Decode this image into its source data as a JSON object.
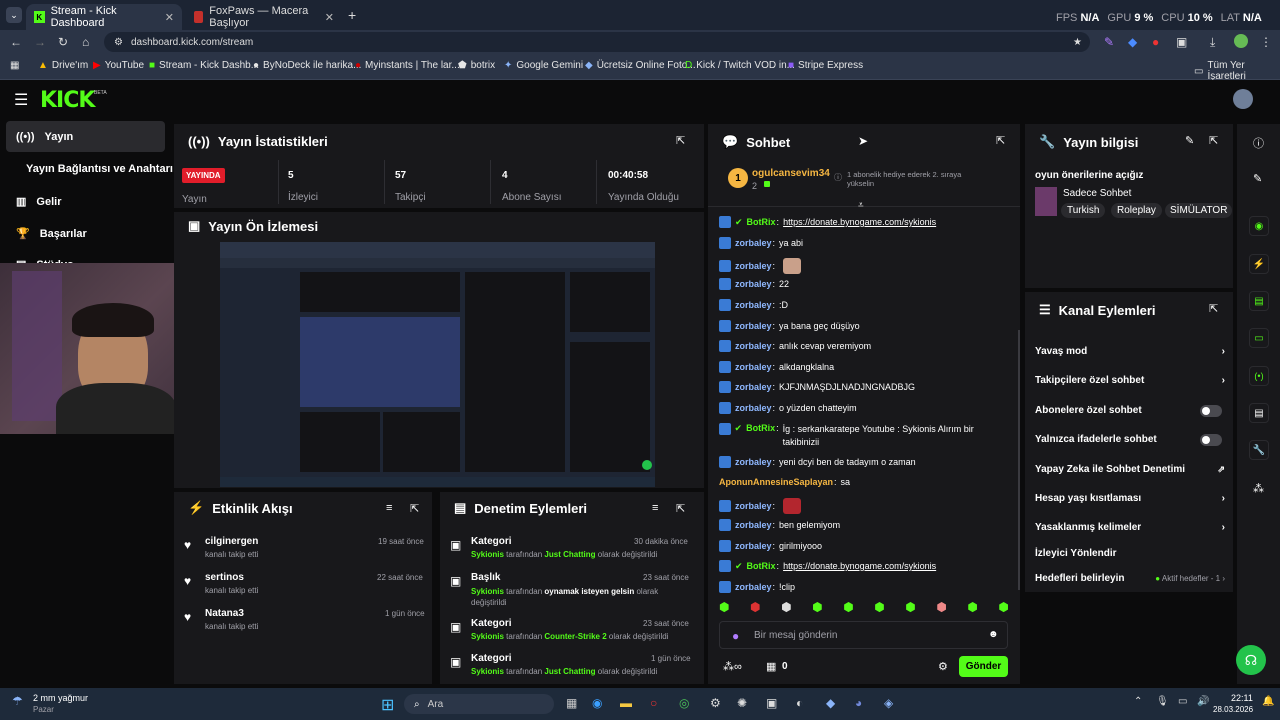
{
  "browser": {
    "tabs": [
      {
        "label": "Stream - Kick Dashboard"
      },
      {
        "label": "FoxPaws — Macera Başlıyor"
      }
    ],
    "url": "dashboard.kick.com/stream",
    "stats": {
      "fps_label": "FPS",
      "fps": "N/A",
      "gpu_label": "GPU",
      "gpu": "9 %",
      "cpu_label": "CPU",
      "cpu": "10 %",
      "lat_label": "LAT",
      "lat": "N/A"
    },
    "bookmarks": [
      "Drive'ım",
      "YouTube",
      "Stream - Kick Dashb...",
      "ByNoDeck ile harika...",
      "Myinstants | The lar...",
      "botrix",
      "Google Gemini",
      "Ücretsiz Online Foto...",
      "Kick / Twitch VOD in...",
      "Stripe Express"
    ],
    "all_bookmarks": "Tüm Yer İşaretleri"
  },
  "app": {
    "logo": "KICK",
    "beta": "BETA"
  },
  "sidebar": {
    "items": [
      {
        "label": "Yayın"
      },
      {
        "label": "Yayın Bağlantısı ve Anahtarı"
      },
      {
        "label": "Gelir"
      },
      {
        "label": "Başarılar"
      },
      {
        "label": "Stüdyo"
      }
    ]
  },
  "stats_panel": {
    "title": "Yayın İstatistikleri",
    "live_badge": "YAYINDA",
    "live_label": "Yayın",
    "metrics": [
      {
        "value": "5",
        "label": "İzleyici"
      },
      {
        "value": "57",
        "label": "Takipçi"
      },
      {
        "value": "4",
        "label": "Abone Sayısı"
      },
      {
        "value": "00:40:58",
        "label": "Yayında Olduğu"
      }
    ]
  },
  "preview_panel": {
    "title": "Yayın Ön İzlemesi"
  },
  "activity": {
    "title": "Etkinlik Akışı",
    "items": [
      {
        "name": "cilginergen",
        "action": "kanalı takip etti",
        "time": "19 saat önce"
      },
      {
        "name": "sertinos",
        "action": "kanalı takip etti",
        "time": "22 saat önce"
      },
      {
        "name": "Natana3",
        "action": "kanalı takip etti",
        "time": "1 gün önce"
      }
    ]
  },
  "moderation": {
    "title": "Denetim Eylemleri",
    "items": [
      {
        "type": "Kategori",
        "time": "30 dakika önce",
        "user": "Sykionis",
        "mid": "tarafından",
        "value": "Just Chatting",
        "end": "olarak değiştirildi"
      },
      {
        "type": "Başlık",
        "time": "23 saat önce",
        "user": "Sykionis",
        "mid": "tarafından",
        "value": "oynamak isteyen gelsin",
        "end": "olarak değiştirildi"
      },
      {
        "type": "Kategori",
        "time": "23 saat önce",
        "user": "Sykionis",
        "mid": "tarafından",
        "value": "Counter-Strike 2",
        "end": "olarak değiştirildi"
      },
      {
        "type": "Kategori",
        "time": "1 gün önce",
        "user": "Sykionis",
        "mid": "tarafından",
        "value": "Just Chatting",
        "end": "olarak değiştirildi"
      }
    ]
  },
  "chat": {
    "title": "Sohbet",
    "pinned_user": "ogulcansevim34",
    "pinned_count": "2",
    "pinned_text": "1 abonelik hediye ederek 2. sıraya yükselin",
    "messages": [
      {
        "user": "BotRix",
        "text": "https://donate.bynogame.com/sykionis",
        "bot": true
      },
      {
        "user": "zorbaley",
        "text": "ya abi"
      },
      {
        "user": "zorbaley",
        "text": ""
      },
      {
        "user": "zorbaley",
        "text": "22"
      },
      {
        "user": "zorbaley",
        "text": ":D"
      },
      {
        "user": "zorbaley",
        "text": "ya bana geç düşüyo"
      },
      {
        "user": "zorbaley",
        "text": "anlık cevap veremiyom"
      },
      {
        "user": "zorbaley",
        "text": "alkdangklalna"
      },
      {
        "user": "zorbaley",
        "text": "KJFJNMAŞDJLNADJNGNADBJG"
      },
      {
        "user": "zorbaley",
        "text": "o yüzden chatteyim"
      },
      {
        "user": "BotRix",
        "text": "İg : serkankaratepe Youtube : Sykionis Alırım bir takibinizii",
        "bot": true
      },
      {
        "user": "zorbaley",
        "text": "yeni dcyi ben de tadayım o zaman"
      },
      {
        "user": "AponunAnnesineSaplayan",
        "text": "sa"
      },
      {
        "user": "zorbaley",
        "text": ""
      },
      {
        "user": "zorbaley",
        "text": "ben gelemiyom"
      },
      {
        "user": "zorbaley",
        "text": "girilmiyooo"
      },
      {
        "user": "BotRix",
        "text": "https://donate.bynogame.com/sykionis",
        "bot": true
      },
      {
        "user": "zorbaley",
        "text": "!clip"
      }
    ],
    "placeholder": "Bir mesaj gönderin",
    "send": "Gönder",
    "gift_count": "0"
  },
  "info": {
    "title": "Yayın bilgisi",
    "stream_title": "oyun önerilerine açığız",
    "category": "Sadece Sohbet",
    "tags": [
      "Turkish",
      "Roleplay",
      "SİMÜLATOR"
    ]
  },
  "channel_actions": {
    "title": "Kanal Eylemleri",
    "items": [
      {
        "label": "Yavaş mod",
        "kind": "arrow"
      },
      {
        "label": "Takipçilere özel sohbet",
        "kind": "arrow"
      },
      {
        "label": "Abonelere özel sohbet",
        "kind": "toggle"
      },
      {
        "label": "Yalnızca ifadelerle sohbet",
        "kind": "toggle"
      },
      {
        "label": "Yapay Zeka ile Sohbet Denetimi",
        "kind": "ext"
      },
      {
        "label": "Hesap yaşı kısıtlaması",
        "kind": "arrow"
      },
      {
        "label": "Yasaklanmış kelimeler",
        "kind": "arrow"
      },
      {
        "label": "İzleyici Yönlendir",
        "kind": "none"
      },
      {
        "label": "Hedefleri belirleyin",
        "kind": "arrow",
        "extra": "Aktif hedefler - 1"
      }
    ]
  },
  "taskbar": {
    "weather": "2 mm yağmur",
    "weather_sub": "Pazar",
    "search": "Ara",
    "time": "22:11",
    "date": "28.03.2026"
  },
  "colors": {
    "accent": "#53fc18",
    "live": "#e11d2a",
    "panel": "#18181b"
  }
}
